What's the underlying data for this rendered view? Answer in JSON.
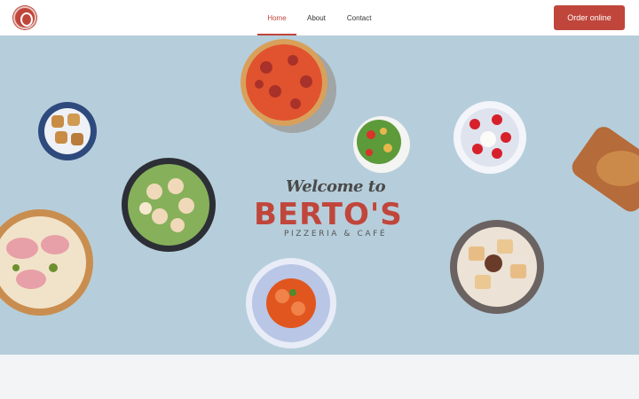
{
  "header": {
    "logo_alt": "Berto's logo",
    "nav": [
      {
        "label": "Home",
        "active": true
      },
      {
        "label": "About",
        "active": false
      },
      {
        "label": "Contact",
        "active": false
      }
    ],
    "order_button": "Order online"
  },
  "hero": {
    "welcome": "Welcome to",
    "brand": "BERTO'S",
    "tagline": "PIZZERIA & CAFÉ"
  },
  "colors": {
    "accent": "#c0463b",
    "hero_bg": "#b6cedb"
  }
}
